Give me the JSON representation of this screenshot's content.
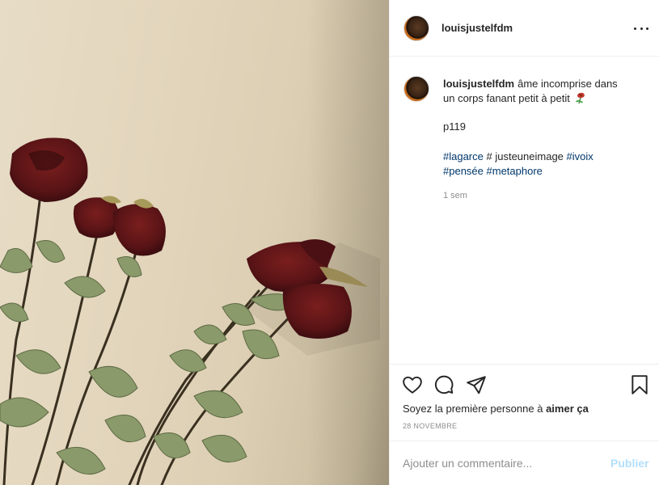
{
  "post": {
    "username": "louisjustelfdm",
    "more_icon": "more-horizontal-icon"
  },
  "caption": {
    "username": "louisjustelfdm",
    "text_part1": "âme incomprise dans",
    "text_part2": "un corps fanant petit à petit",
    "emoji": "wilted-rose-emoji",
    "line2": "p119",
    "tags": {
      "t1": "#lagarce",
      "t2": "# justeuneimage",
      "t3": "#ivoix",
      "t4": "#pensée",
      "t5": "#metaphore"
    },
    "time_ago": "1 sem"
  },
  "actions": {
    "like_icon": "heart-icon",
    "comment_icon": "comment-icon",
    "share_icon": "paper-plane-icon",
    "save_icon": "bookmark-icon",
    "likes_prefix": "Soyez la première personne à",
    "likes_bold": "aimer ça",
    "date": "28 NOVEMBRE"
  },
  "comment": {
    "placeholder": "Ajouter un commentaire...",
    "publish_label": "Publier"
  },
  "colors": {
    "text": "#262626",
    "muted": "#8e8e8e",
    "link": "#00376b",
    "publish_disabled": "#b2dffc",
    "border": "#efefef"
  }
}
